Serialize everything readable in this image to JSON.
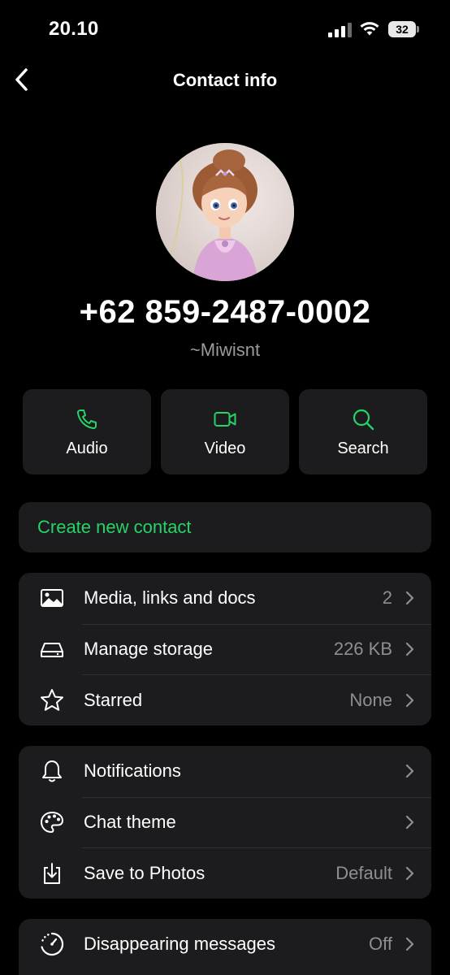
{
  "status_bar": {
    "time": "20.10",
    "battery_level": "32"
  },
  "nav": {
    "title": "Contact info"
  },
  "profile": {
    "phone": "+62 859-2487-0002",
    "nickname": "~Miwisnt"
  },
  "actions": [
    {
      "label": "Audio",
      "icon": "phone-icon"
    },
    {
      "label": "Video",
      "icon": "video-icon"
    },
    {
      "label": "Search",
      "icon": "search-icon"
    }
  ],
  "create_contact": {
    "label": "Create new contact"
  },
  "media_section": [
    {
      "label": "Media, links and docs",
      "value": "2",
      "icon": "image-icon"
    },
    {
      "label": "Manage storage",
      "value": "226 KB",
      "icon": "storage-icon"
    },
    {
      "label": "Starred",
      "value": "None",
      "icon": "star-icon"
    }
  ],
  "settings_section": [
    {
      "label": "Notifications",
      "value": "",
      "icon": "bell-icon"
    },
    {
      "label": "Chat theme",
      "value": "",
      "icon": "palette-icon"
    },
    {
      "label": "Save to Photos",
      "value": "Default",
      "icon": "download-icon"
    }
  ],
  "disappearing_section": [
    {
      "label": "Disappearing messages",
      "value": "Off",
      "icon": "timer-icon"
    }
  ],
  "colors": {
    "accent": "#25d366",
    "background": "#000000",
    "card": "#1c1c1e",
    "secondary_text": "#8e8e93"
  }
}
